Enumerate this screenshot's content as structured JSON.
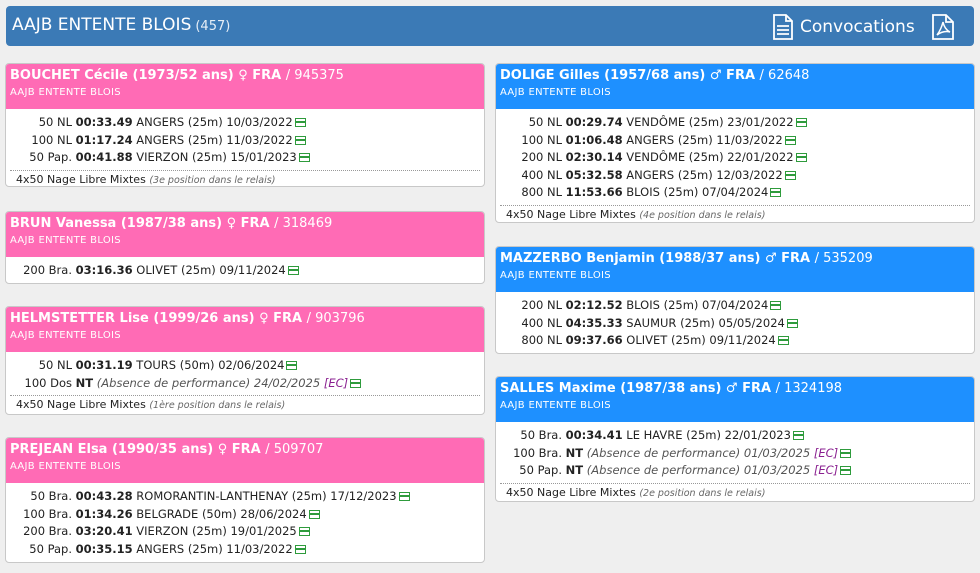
{
  "header": {
    "title": "AAJB ENTENTE BLOIS",
    "count": "(457)",
    "convocations": "Convocations"
  },
  "colors": {
    "female": "#ff6bb5",
    "male": "#1e90ff",
    "header": "#3b7ab6"
  },
  "swimmers": [
    {
      "id": "bouchet",
      "name": "BOUCHET Cécile (1973/52 ans) ♀ FRA",
      "license": "/ 945375",
      "club": "AAJB ENTENTE BLOIS",
      "results": [
        {
          "event": "50 NL",
          "time": "00:33.49",
          "info": "ANGERS (25m) 10/03/2022"
        },
        {
          "event": "100 NL",
          "time": "01:17.24",
          "info": "ANGERS (25m) 11/03/2022"
        },
        {
          "event": "50 Pap.",
          "time": "00:41.88",
          "info": "VIERZON (25m) 15/01/2023"
        }
      ],
      "relay": {
        "name": "4x50 Nage Libre Mixtes",
        "position": "(3e position dans le relais)"
      }
    },
    {
      "id": "brun",
      "name": "BRUN Vanessa (1987/38 ans) ♀ FRA",
      "license": "/ 318469",
      "club": "AAJB ENTENTE BLOIS",
      "results": [
        {
          "event": "200 Bra.",
          "time": "03:16.36",
          "info": "OLIVET (25m) 09/11/2024"
        }
      ]
    },
    {
      "id": "helmstetter",
      "name": "HELMSTETTER Lise (1999/26 ans) ♀ FRA",
      "license": "/ 903796",
      "club": "AAJB ENTENTE BLOIS",
      "results": [
        {
          "event": "50 NL",
          "time": "00:31.19",
          "info": "TOURS (50m) 02/06/2024"
        },
        {
          "event": "100 Dos",
          "time": "NT",
          "absence": "(Absence de performance) 24/02/2025",
          "ec": "[EC]"
        }
      ],
      "relay": {
        "name": "4x50 Nage Libre Mixtes",
        "position": "(1ère position dans le relais)"
      }
    },
    {
      "id": "prejean",
      "name": "PREJEAN Elsa (1990/35 ans) ♀ FRA",
      "license": "/ 509707",
      "club": "AAJB ENTENTE BLOIS",
      "results": [
        {
          "event": "50 Bra.",
          "time": "00:43.28",
          "info": "ROMORANTIN-LANTHENAY (25m) 17/12/2023"
        },
        {
          "event": "100 Bra.",
          "time": "01:34.26",
          "info": "BELGRADE (50m) 28/06/2024"
        },
        {
          "event": "200 Bra.",
          "time": "03:20.41",
          "info": "VIERZON (25m) 19/01/2025"
        },
        {
          "event": "50 Pap.",
          "time": "00:35.15",
          "info": "ANGERS (25m) 11/03/2022"
        }
      ]
    },
    {
      "id": "dolige",
      "name": "DOLIGE Gilles (1957/68 ans) ♂ FRA",
      "license": "/ 62648",
      "club": "AAJB ENTENTE BLOIS",
      "results": [
        {
          "event": "50 NL",
          "time": "00:29.74",
          "info": "VENDÔME (25m) 23/01/2022"
        },
        {
          "event": "100 NL",
          "time": "01:06.48",
          "info": "ANGERS (25m) 11/03/2022"
        },
        {
          "event": "200 NL",
          "time": "02:30.14",
          "info": "VENDÔME (25m) 22/01/2022"
        },
        {
          "event": "400 NL",
          "time": "05:32.58",
          "info": "ANGERS (25m) 12/03/2022"
        },
        {
          "event": "800 NL",
          "time": "11:53.66",
          "info": "BLOIS (25m) 07/04/2024"
        }
      ],
      "relay": {
        "name": "4x50 Nage Libre Mixtes",
        "position": "(4e position dans le relais)"
      }
    },
    {
      "id": "mazzerbo",
      "name": "MAZZERBO Benjamin (1988/37 ans) ♂ FRA",
      "license": "/ 535209",
      "club": "AAJB ENTENTE BLOIS",
      "results": [
        {
          "event": "200 NL",
          "time": "02:12.52",
          "info": "BLOIS (25m) 07/04/2024"
        },
        {
          "event": "400 NL",
          "time": "04:35.33",
          "info": "SAUMUR (25m) 05/05/2024"
        },
        {
          "event": "800 NL",
          "time": "09:37.66",
          "info": "OLIVET (25m) 09/11/2024"
        }
      ]
    },
    {
      "id": "salles",
      "name": "SALLES Maxime (1987/38 ans) ♂ FRA",
      "license": "/ 1324198",
      "club": "AAJB ENTENTE BLOIS",
      "results": [
        {
          "event": "50 Bra.",
          "time": "00:34.41",
          "info": "LE HAVRE (25m) 22/01/2023"
        },
        {
          "event": "100 Bra.",
          "time": "NT",
          "absence": "(Absence de performance) 01/03/2025",
          "ec": "[EC]"
        },
        {
          "event": "50 Pap.",
          "time": "NT",
          "absence": "(Absence de performance) 01/03/2025",
          "ec": "[EC]"
        }
      ],
      "relay": {
        "name": "4x50 Nage Libre Mixtes",
        "position": "(2e position dans le relais)"
      }
    }
  ]
}
